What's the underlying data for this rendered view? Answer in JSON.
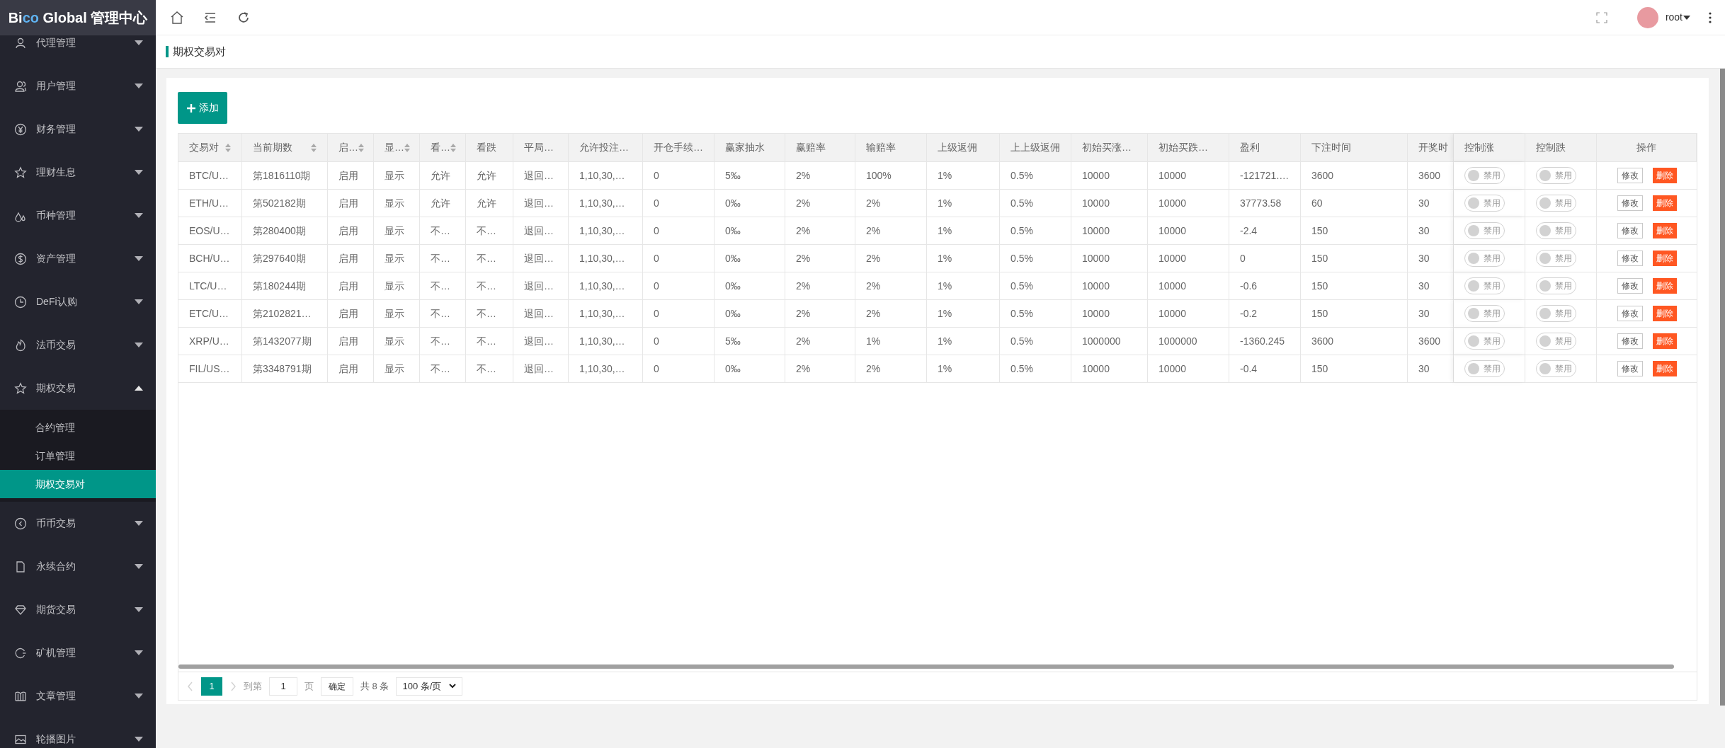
{
  "logo": [
    {
      "text": "Bi",
      "color": "#ffffff"
    },
    {
      "text": "co",
      "color": "#5fb2f0"
    },
    {
      "text": " Global 管理中心",
      "color": "#ffffff"
    }
  ],
  "sidebar": {
    "items": [
      {
        "label": "代理管理",
        "expanded": false
      },
      {
        "label": "用户管理",
        "expanded": false
      },
      {
        "label": "财务管理",
        "expanded": false
      },
      {
        "label": "理财生息",
        "expanded": false
      },
      {
        "label": "币种管理",
        "expanded": false
      },
      {
        "label": "资产管理",
        "expanded": false
      },
      {
        "label": "DeFi认购",
        "expanded": false
      },
      {
        "label": "法币交易",
        "expanded": false
      },
      {
        "label": "期权交易",
        "expanded": true,
        "children": [
          {
            "label": "合约管理",
            "selected": false
          },
          {
            "label": "订单管理",
            "selected": false
          },
          {
            "label": "期权交易对",
            "selected": true
          }
        ]
      },
      {
        "label": "币币交易",
        "expanded": false
      },
      {
        "label": "永续合约",
        "expanded": false
      },
      {
        "label": "期货交易",
        "expanded": false
      },
      {
        "label": "矿机管理",
        "expanded": false
      },
      {
        "label": "文章管理",
        "expanded": false
      },
      {
        "label": "轮播图片",
        "expanded": false
      }
    ]
  },
  "user": {
    "name": "root"
  },
  "breadcrumb": "期权交易对",
  "add_button": "添加",
  "table": {
    "columns": [
      {
        "label": "交易对",
        "sortable": true
      },
      {
        "label": "当前期数",
        "sortable": true
      },
      {
        "label": "启…",
        "sortable": true
      },
      {
        "label": "显…",
        "sortable": true
      },
      {
        "label": "看…",
        "sortable": true
      },
      {
        "label": "看跌",
        "sortable": false
      },
      {
        "label": "平局…",
        "sortable": false
      },
      {
        "label": "允许投注…",
        "sortable": false
      },
      {
        "label": "开仓手续…",
        "sortable": false
      },
      {
        "label": "赢家抽水",
        "sortable": false
      },
      {
        "label": "赢赔率",
        "sortable": false
      },
      {
        "label": "输赔率",
        "sortable": false
      },
      {
        "label": "上级返佣",
        "sortable": false
      },
      {
        "label": "上上级返佣",
        "sortable": false
      },
      {
        "label": "初始买涨…",
        "sortable": false
      },
      {
        "label": "初始买跌…",
        "sortable": false
      },
      {
        "label": "盈利",
        "sortable": false
      },
      {
        "label": "下注时间",
        "sortable": false
      },
      {
        "label": "开奖时",
        "sortable": false
      },
      {
        "label": "控制涨",
        "sortable": false
      },
      {
        "label": "控制跌",
        "sortable": false
      },
      {
        "label": "操作",
        "sortable": false
      }
    ],
    "rows": [
      {
        "cells": [
          "BTC/U…",
          "第1816110期",
          "启用",
          "显示",
          "允许",
          "允许",
          "退回…",
          "1,10,30,…",
          "0",
          "5‰",
          "2%",
          "100%",
          "1%",
          "0.5%",
          "10000",
          "10000",
          "-121721.…",
          "3600",
          "3600"
        ],
        "control_up": {
          "label": "禁用",
          "on": false
        },
        "control_down": {
          "label": "禁用",
          "on": false
        },
        "actions": [
          "修改",
          "删除"
        ]
      },
      {
        "cells": [
          "ETH/U…",
          "第502182期",
          "启用",
          "显示",
          "允许",
          "允许",
          "退回…",
          "1,10,30,…",
          "0",
          "0‰",
          "2%",
          "2%",
          "1%",
          "0.5%",
          "10000",
          "10000",
          "37773.58",
          "60",
          "30"
        ],
        "control_up": {
          "label": "禁用",
          "on": false
        },
        "control_down": {
          "label": "禁用",
          "on": false
        },
        "actions": [
          "修改",
          "删除"
        ]
      },
      {
        "cells": [
          "EOS/U…",
          "第280400期",
          "启用",
          "显示",
          "不…",
          "不…",
          "退回…",
          "1,10,30,…",
          "0",
          "0‰",
          "2%",
          "2%",
          "1%",
          "0.5%",
          "10000",
          "10000",
          "-2.4",
          "150",
          "30"
        ],
        "control_up": {
          "label": "禁用",
          "on": false
        },
        "control_down": {
          "label": "禁用",
          "on": false
        },
        "actions": [
          "修改",
          "删除"
        ]
      },
      {
        "cells": [
          "BCH/U…",
          "第297640期",
          "启用",
          "显示",
          "不…",
          "不…",
          "退回…",
          "1,10,30,…",
          "0",
          "0‰",
          "2%",
          "2%",
          "1%",
          "0.5%",
          "10000",
          "10000",
          "0",
          "150",
          "30"
        ],
        "control_up": {
          "label": "禁用",
          "on": false
        },
        "control_down": {
          "label": "禁用",
          "on": false
        },
        "actions": [
          "修改",
          "删除"
        ]
      },
      {
        "cells": [
          "LTC/U…",
          "第180244期",
          "启用",
          "显示",
          "不…",
          "不…",
          "退回…",
          "1,10,30,…",
          "0",
          "0‰",
          "2%",
          "2%",
          "1%",
          "0.5%",
          "10000",
          "10000",
          "-0.6",
          "150",
          "30"
        ],
        "control_up": {
          "label": "禁用",
          "on": false
        },
        "control_down": {
          "label": "禁用",
          "on": false
        },
        "actions": [
          "修改",
          "删除"
        ]
      },
      {
        "cells": [
          "ETC/U…",
          "第2102821…",
          "启用",
          "显示",
          "不…",
          "不…",
          "退回…",
          "1,10,30,…",
          "0",
          "0‰",
          "2%",
          "2%",
          "1%",
          "0.5%",
          "10000",
          "10000",
          "-0.2",
          "150",
          "30"
        ],
        "control_up": {
          "label": "禁用",
          "on": false
        },
        "control_down": {
          "label": "禁用",
          "on": false
        },
        "actions": [
          "修改",
          "删除"
        ]
      },
      {
        "cells": [
          "XRP/U…",
          "第1432077期",
          "启用",
          "显示",
          "不…",
          "不…",
          "退回…",
          "1,10,30,…",
          "0",
          "5‰",
          "2%",
          "1%",
          "1%",
          "0.5%",
          "1000000",
          "1000000",
          "-1360.245",
          "3600",
          "3600"
        ],
        "control_up": {
          "label": "禁用",
          "on": false
        },
        "control_down": {
          "label": "禁用",
          "on": false
        },
        "actions": [
          "修改",
          "删除"
        ]
      },
      {
        "cells": [
          "FIL/US…",
          "第3348791期",
          "启用",
          "显示",
          "不…",
          "不…",
          "退回…",
          "1,10,30,…",
          "0",
          "0‰",
          "2%",
          "2%",
          "1%",
          "0.5%",
          "10000",
          "10000",
          "-0.4",
          "150",
          "30"
        ],
        "control_up": {
          "label": "禁用",
          "on": false
        },
        "control_down": {
          "label": "禁用",
          "on": false
        },
        "actions": [
          "修改",
          "删除"
        ]
      }
    ]
  },
  "pagination": {
    "pages": [
      {
        "label": "1",
        "selected": true
      }
    ],
    "goto_label": "到第",
    "goto_value": "1",
    "page_unit": "页",
    "confirm": "确定",
    "total": "共 8 条",
    "page_size": "100 条/页"
  }
}
